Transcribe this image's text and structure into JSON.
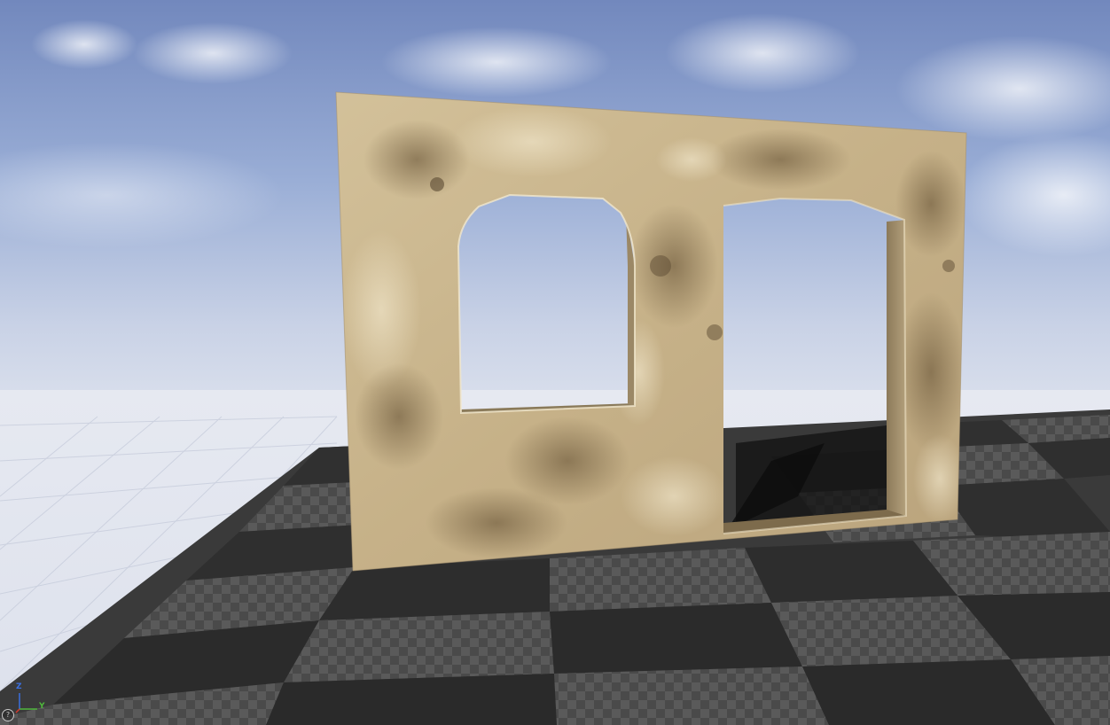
{
  "viewport": {
    "name": "level-viewport"
  },
  "gizmo": {
    "z_label": "Z",
    "y_label": "Y",
    "help_glyph": "?"
  },
  "colors": {
    "sky_top": "#7e94c4",
    "sky_horizon": "#e2e6ee",
    "floor_dark": "#333333",
    "floor_light": "#5c5c5c",
    "wall_stone": "#c8b48c",
    "axis_z": "#3a6fe0",
    "axis_y": "#4fb83c",
    "axis_x": "#d63a2e"
  },
  "icons": [
    "axis-gizmo-icon",
    "help-icon"
  ]
}
